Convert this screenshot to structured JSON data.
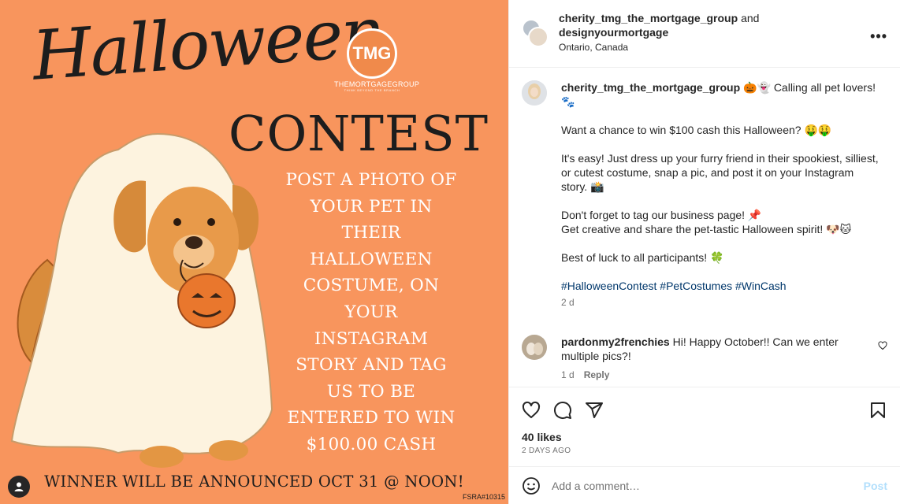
{
  "image": {
    "title_script": "Halloween",
    "title_contest": "CONTEST",
    "logo_initials": "TMG",
    "logo_name": "THEMORTGAGEGROUP",
    "logo_tagline": "THINK BEYOND THE BRANCH",
    "promo_lines": [
      "POST A PHOTO OF",
      "YOUR PET IN",
      "THEIR",
      "HALLOWEEN",
      "COSTUME, ON",
      "YOUR",
      "INSTAGRAM",
      "STORY AND TAG",
      "US TO BE",
      "ENTERED TO WIN",
      "$100.00 CASH"
    ],
    "winner": "WINNER WILL BE ANNOUNCED OCT 31 @ NOON!",
    "fsra": "FSRA#10315",
    "background_color": "#f8955d"
  },
  "header": {
    "user1": "cherity_tmg_the_mortgage_group",
    "and": "and",
    "user2": "designyourmortgage",
    "location": "Ontario, Canada",
    "more_icon": "more-horizontal-icon"
  },
  "caption": {
    "username": "cherity_tmg_the_mortgage_group",
    "line1": "🎃👻 Calling all pet lovers! 🐾",
    "line2": "Want a chance to win $100 cash this Halloween? 🤑🤑",
    "line3": "It's easy! Just dress up your furry friend in their spookiest, silliest, or cutest costume, snap a pic, and post it on your Instagram story. 📸",
    "line4a": "Don't forget to tag our business page! 📌",
    "line4b": "Get creative and share the pet-tastic Halloween spirit! 🐶🐱",
    "line5": "Best of luck to all participants! 🍀",
    "hashtags": "#HalloweenContest #PetCostumes #WinCash",
    "time": "2 d"
  },
  "comment": {
    "username": "pardonmy2frenchies",
    "text": "Hi! Happy October!! Can we enter multiple pics?!",
    "time": "1 d",
    "reply": "Reply"
  },
  "actions": {
    "likes": "40 likes",
    "date": "2 DAYS AGO"
  },
  "add_comment": {
    "placeholder": "Add a comment…",
    "post_label": "Post"
  }
}
